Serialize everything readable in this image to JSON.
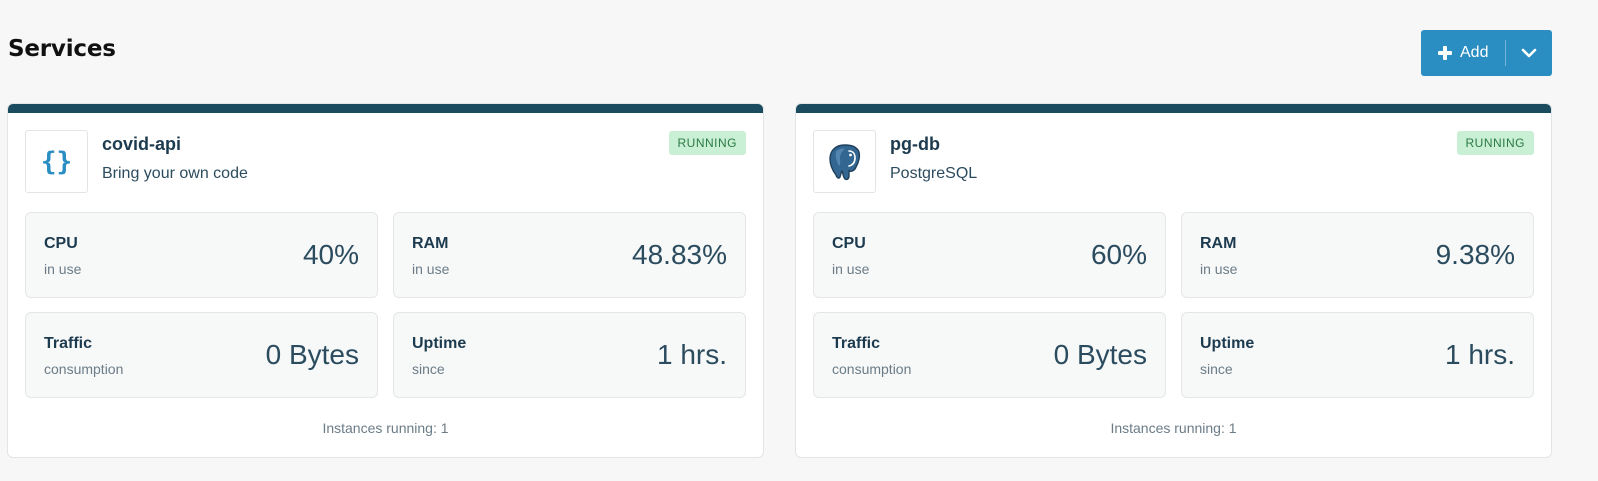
{
  "page": {
    "title": "Services"
  },
  "toolbar": {
    "add_label": "Add"
  },
  "colors": {
    "accent": "#2a8ec2",
    "card_topbar": "#1a4b5f",
    "running_bg": "#c9efd4",
    "running_text": "#2c7a45"
  },
  "services": [
    {
      "name": "covid-api",
      "type": "Bring your own code",
      "icon": "code-braces-icon",
      "status": "RUNNING",
      "metrics": {
        "cpu": {
          "label": "CPU",
          "sub": "in use",
          "value": "40%"
        },
        "ram": {
          "label": "RAM",
          "sub": "in use",
          "value": "48.83%"
        },
        "traffic": {
          "label": "Traffic",
          "sub": "consumption",
          "value": "0 Bytes"
        },
        "uptime": {
          "label": "Uptime",
          "sub": "since",
          "value": "1 hrs."
        }
      },
      "instances": "Instances running: 1"
    },
    {
      "name": "pg-db",
      "type": "PostgreSQL",
      "icon": "postgresql-elephant-icon",
      "status": "RUNNING",
      "metrics": {
        "cpu": {
          "label": "CPU",
          "sub": "in use",
          "value": "60%"
        },
        "ram": {
          "label": "RAM",
          "sub": "in use",
          "value": "9.38%"
        },
        "traffic": {
          "label": "Traffic",
          "sub": "consumption",
          "value": "0 Bytes"
        },
        "uptime": {
          "label": "Uptime",
          "sub": "since",
          "value": "1 hrs."
        }
      },
      "instances": "Instances running: 1"
    }
  ]
}
